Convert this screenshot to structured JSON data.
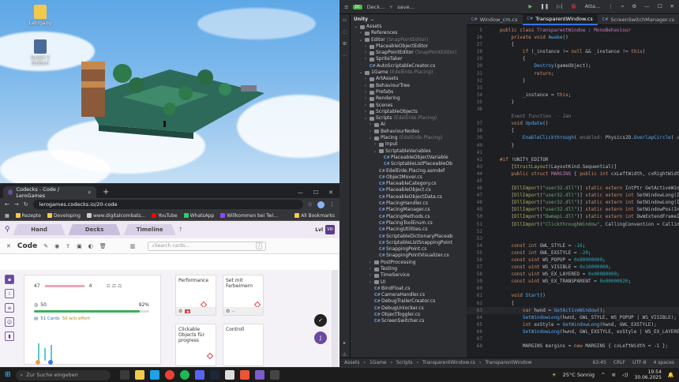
{
  "desktop": {
    "icons": [
      {
        "name": "folder-icon",
        "label": "Lehrgang"
      },
      {
        "name": "app-shortcut-icon",
        "label": "Godot 3 (Editor)"
      }
    ]
  },
  "browser": {
    "tab_title": "Codecks - Code / LeroGames",
    "url": "lerogames.codecks.io/20-code",
    "bookmarks": [
      "Rezepte",
      "Developing",
      "www.digitalcombats...",
      "YouTube",
      "WhatsApp",
      "Willkommen bei Twi..."
    ],
    "all_bookmarks": "All Bookmarks",
    "colors": {
      "youtube": "#ff0000",
      "whatsapp": "#25d366",
      "twitch": "#9146ff"
    }
  },
  "codecks": {
    "nav_tabs": [
      "Hand",
      "Decks",
      "Timeline"
    ],
    "level_label": "Lvl",
    "level_value": "VIII",
    "page_title": "Code",
    "search_placeholder": "Search cards...",
    "search_shortcut": "/",
    "stats": {
      "left_count": "47",
      "right_count": "4",
      "points": "50",
      "progress_percent": "92%",
      "progress_fraction": 0.92,
      "cards_label": "51 Cards",
      "effort_label": "50 w/o effort"
    },
    "cards": [
      {
        "title": "Performance"
      },
      {
        "title": "Set mit Farbeimern"
      },
      {
        "title": "Clickable Objects für progress"
      },
      {
        "title": "Controll"
      }
    ],
    "accent_color": "#6b4aa0"
  },
  "ide": {
    "project_name": "Deck...",
    "branch": "save...",
    "run_config": "Atta...",
    "tree_title": "Unity",
    "tree": [
      {
        "indent": 0,
        "arrow": "v",
        "label": "Assets",
        "note": ""
      },
      {
        "indent": 1,
        "arrow": ">",
        "label": "References",
        "note": ""
      },
      {
        "indent": 1,
        "arrow": "v",
        "label": "Editor",
        "note": "(SnapPointEditor)"
      },
      {
        "indent": 2,
        "arrow": ">",
        "label": "PlaceableObjectEditor",
        "note": ""
      },
      {
        "indent": 2,
        "arrow": ">",
        "label": "SnapPointEditor",
        "note": "(SnapPointEditor)"
      },
      {
        "indent": 2,
        "arrow": ">",
        "label": "SpriteTaker",
        "note": ""
      },
      {
        "indent": 2,
        "arrow": "",
        "label": "AutoScriptableCreator.cs",
        "note": ""
      },
      {
        "indent": 1,
        "arrow": "v",
        "label": "1Game",
        "note": "(EdelErde.Placing)"
      },
      {
        "indent": 2,
        "arrow": ">",
        "label": "ArtAssets",
        "note": ""
      },
      {
        "indent": 2,
        "arrow": ">",
        "label": "BehaviourTree",
        "note": ""
      },
      {
        "indent": 2,
        "arrow": ">",
        "label": "Prefabs",
        "note": ""
      },
      {
        "indent": 2,
        "arrow": ">",
        "label": "Rendering",
        "note": ""
      },
      {
        "indent": 2,
        "arrow": ">",
        "label": "Scenes",
        "note": ""
      },
      {
        "indent": 2,
        "arrow": ">",
        "label": "ScriptableObjects",
        "note": ""
      },
      {
        "indent": 2,
        "arrow": "v",
        "label": "Scripts",
        "note": "(EdelErde.Placing)"
      },
      {
        "indent": 3,
        "arrow": ">",
        "label": "AI",
        "note": ""
      },
      {
        "indent": 3,
        "arrow": ">",
        "label": "BehaviourNodes",
        "note": ""
      },
      {
        "indent": 3,
        "arrow": "v",
        "label": "Placing",
        "note": "(EdelErde.Placing)"
      },
      {
        "indent": 4,
        "arrow": ">",
        "label": "Input",
        "note": ""
      },
      {
        "indent": 4,
        "arrow": "v",
        "label": "ScriptableVariables",
        "note": ""
      },
      {
        "indent": 5,
        "arrow": "",
        "label": "PlaceableObjectVariable",
        "note": ""
      },
      {
        "indent": 5,
        "arrow": "",
        "label": "ScriptableListPlaceableOb",
        "note": ""
      },
      {
        "indent": 4,
        "arrow": "",
        "label": "EdelErde.Placing.asmdef",
        "note": ""
      },
      {
        "indent": 4,
        "arrow": "",
        "label": "ObjectMover.cs",
        "note": ""
      },
      {
        "indent": 4,
        "arrow": "",
        "label": "PlaceableCategory.cs",
        "note": ""
      },
      {
        "indent": 4,
        "arrow": "",
        "label": "PlaceableObject.cs",
        "note": ""
      },
      {
        "indent": 4,
        "arrow": "",
        "label": "PlaceableObjectData.cs",
        "note": ""
      },
      {
        "indent": 4,
        "arrow": "",
        "label": "PlacingHandler.cs",
        "note": ""
      },
      {
        "indent": 4,
        "arrow": "",
        "label": "PlacingManager.cs",
        "note": ""
      },
      {
        "indent": 4,
        "arrow": "",
        "label": "PlacingMethods.cs",
        "note": ""
      },
      {
        "indent": 4,
        "arrow": "",
        "label": "PlacingToolEnum.cs",
        "note": ""
      },
      {
        "indent": 4,
        "arrow": "",
        "label": "PlacingUtilities.cs",
        "note": ""
      },
      {
        "indent": 4,
        "arrow": "",
        "label": "ScriptableDictionaryPlaceab",
        "note": ""
      },
      {
        "indent": 4,
        "arrow": "",
        "label": "ScriptableListSnappingPoint",
        "note": ""
      },
      {
        "indent": 4,
        "arrow": "",
        "label": "SnappingPoint.cs",
        "note": ""
      },
      {
        "indent": 4,
        "arrow": "",
        "label": "SnappingPointVisualizer.cs",
        "note": ""
      },
      {
        "indent": 3,
        "arrow": ">",
        "label": "PostProcessing",
        "note": ""
      },
      {
        "indent": 3,
        "arrow": ">",
        "label": "Testing",
        "note": ""
      },
      {
        "indent": 3,
        "arrow": ">",
        "label": "TimeService",
        "note": ""
      },
      {
        "indent": 3,
        "arrow": ">",
        "label": "UI",
        "note": ""
      },
      {
        "indent": 3,
        "arrow": "",
        "label": "BindFloat.cs",
        "note": ""
      },
      {
        "indent": 3,
        "arrow": "",
        "label": "CameraHandler.cs",
        "note": ""
      },
      {
        "indent": 3,
        "arrow": "",
        "label": "DebugTrailerCreator.cs",
        "note": ""
      },
      {
        "indent": 3,
        "arrow": "",
        "label": "DebugUnlocker.cs",
        "note": ""
      },
      {
        "indent": 3,
        "arrow": "",
        "label": "ObjectToggler.cs",
        "note": ""
      },
      {
        "indent": 3,
        "arrow": "",
        "label": "ScreenSwitcher.cs",
        "note": ""
      }
    ],
    "editor_tabs": [
      {
        "label": "Window_cm.cs",
        "active": false
      },
      {
        "label": "TransparentWindow.cs",
        "active": true
      },
      {
        "label": "ScreenSwitchManager.cs",
        "active": false
      }
    ],
    "code_lines": [
      {
        "n": "5",
        "html": "<span class=\"kw\">public class</span> <span class=\"ty\">TransparentWindow</span> : <span class=\"ty\">MonoBehaviour</span>"
      },
      {
        "n": "26",
        "html": "    <span class=\"kw\">private void</span> <span class=\"fn\">Awake</span>()"
      },
      {
        "n": "27",
        "html": "    {"
      },
      {
        "n": "28",
        "html": "        <span class=\"kw\">if</span> (_instance != <span class=\"kw\">null</span> &amp;&amp; _instance != <span class=\"kw\">this</span>)"
      },
      {
        "n": "29",
        "html": "        {"
      },
      {
        "n": "30",
        "html": "            <span class=\"fn\">Destroy</span>(gameObject);"
      },
      {
        "n": "31",
        "html": "            <span class=\"kw\">return</span>;"
      },
      {
        "n": "32",
        "html": "        }"
      },
      {
        "n": "33",
        "html": ""
      },
      {
        "n": "34",
        "html": "        _instance = <span class=\"kw\">this</span>;"
      },
      {
        "n": "35",
        "html": "    }"
      },
      {
        "n": "36",
        "html": ""
      },
      {
        "n": "",
        "html": "    <span class=\"cm\">Event function  · Jan</span>"
      },
      {
        "n": "37",
        "html": "    <span class=\"kw\">void</span> <span class=\"fn\">Update</span>()"
      },
      {
        "n": "38",
        "html": "    {"
      },
      {
        "n": "39",
        "html": "        <span class=\"fn\">EnableClickthrough</span>( <span class=\"cm\">enabled:</span> Physics2D.<span class=\"fn\">OverlapCircle</span>( <span class=\"cm\">a:</span> tra"
      },
      {
        "n": "40",
        "html": "    }"
      },
      {
        "n": "41",
        "html": ""
      },
      {
        "n": "42",
        "html": "<span class=\"kw\">#if</span> !UNITY_EDITOR"
      },
      {
        "n": "43",
        "html": "    [<span class=\"at\">StructLayout</span>(LayoutKind.Sequential)]"
      },
      {
        "n": "44",
        "html": "    <span class=\"kw\">public struct</span> <span class=\"ty\">MARGINS</span> { <span class=\"kw\">public int</span> cxLeftWidth, cxRightWidth"
      },
      {
        "n": "45",
        "html": ""
      },
      {
        "n": "46",
        "html": "    [<span class=\"at\">DllImport</span>(<span class=\"st\">\"user32.dll\"</span>)] <span class=\"kw\">static extern</span> IntPtr GetActiveWind"
      },
      {
        "n": "47",
        "html": "    [<span class=\"at\">DllImport</span>(<span class=\"st\">\"user32.dll\"</span>)] <span class=\"kw\">static extern int</span> SetWindowLong(In"
      },
      {
        "n": "48",
        "html": "    [<span class=\"at\">DllImport</span>(<span class=\"st\">\"user32.dll\"</span>)] <span class=\"kw\">static extern int</span> GetWindowLong(In"
      },
      {
        "n": "49",
        "html": "    [<span class=\"at\">DllImport</span>(<span class=\"st\">\"user32.dll\"</span>)] <span class=\"kw\">static extern int</span> SetWindowPos(Int"
      },
      {
        "n": "50",
        "html": "    [<span class=\"at\">DllImport</span>(<span class=\"st\">\"Dwmapi.dll\"</span>)] <span class=\"kw\">static extern int</span> DwmExtendFrameIn"
      },
      {
        "n": "51",
        "html": "    [<span class=\"at\">DllImport</span>(<span class=\"st\">\"ClickthroughWindow\"</span>, CallingConvention = Callin"
      },
      {
        "n": "52",
        "html": ""
      },
      {
        "n": "53",
        "html": ""
      },
      {
        "n": "54",
        "html": "    <span class=\"kw\">const int</span> GWL_STYLE = <span class=\"nm\">-16</span>;"
      },
      {
        "n": "55",
        "html": "    <span class=\"kw\">const int</span> GWL_EXSTYLE = <span class=\"nm\">-20</span>;"
      },
      {
        "n": "56",
        "html": "    <span class=\"kw\">const uint</span> WS_POPUP = <span class=\"nm\">0x80000000</span>;"
      },
      {
        "n": "57",
        "html": "    <span class=\"kw\">const uint</span> WS_VISIBLE = <span class=\"nm\">0x10000000</span>;"
      },
      {
        "n": "58",
        "html": "    <span class=\"kw\">const uint</span> WS_EX_LAYERED = <span class=\"nm\">0x00080000</span>;"
      },
      {
        "n": "59",
        "html": "    <span class=\"kw\">const uint</span> WS_EX_TRANSPARENT = <span class=\"nm\">0x00000020</span>;"
      },
      {
        "n": "60",
        "html": ""
      },
      {
        "n": "61",
        "html": "    <span class=\"kw\">void</span> <span class=\"fn\">Start</span>()"
      },
      {
        "n": "62",
        "html": "    {"
      },
      {
        "n": "63",
        "html": "        <span class=\"kw\">var</span> hwnd = <span class=\"fn\">GetActiveWindow</span>();"
      },
      {
        "n": "64",
        "html": "        <span class=\"fn\">SetWindowLong</span>(hwnd, GWL_STYLE, WS_POPUP | WS_VISIBLE);"
      },
      {
        "n": "65",
        "html": "        <span class=\"kw\">int</span> exStyle = <span class=\"fn\">GetWindowLong</span>(hwnd, GWL_EXSTYLE);"
      },
      {
        "n": "66",
        "html": "        <span class=\"fn\">SetWindowLong</span>(hwnd, GWL_EXSTYLE, exStyle | WS_EX_LAYERED);"
      },
      {
        "n": "67",
        "html": ""
      },
      {
        "n": "68",
        "html": "        MARGINS margins = <span class=\"kw\">new</span> MARGINS { cxLeftWidth = -1 };"
      }
    ],
    "breadcrumb": [
      "Assets",
      "1Game",
      "Scripts",
      "TransparentWindow.cs",
      "TransparentWindow"
    ],
    "status": {
      "position": "63:45",
      "line_sep": "CRLF",
      "encoding": "UTF-8",
      "indent": "4 spaces"
    }
  },
  "taskbar": {
    "weather_temp": "25°C",
    "weather_text": "Sonnig",
    "search_placeholder": "Zur Suche eingeben",
    "time": "19:54",
    "date": "30.06.2025"
  }
}
